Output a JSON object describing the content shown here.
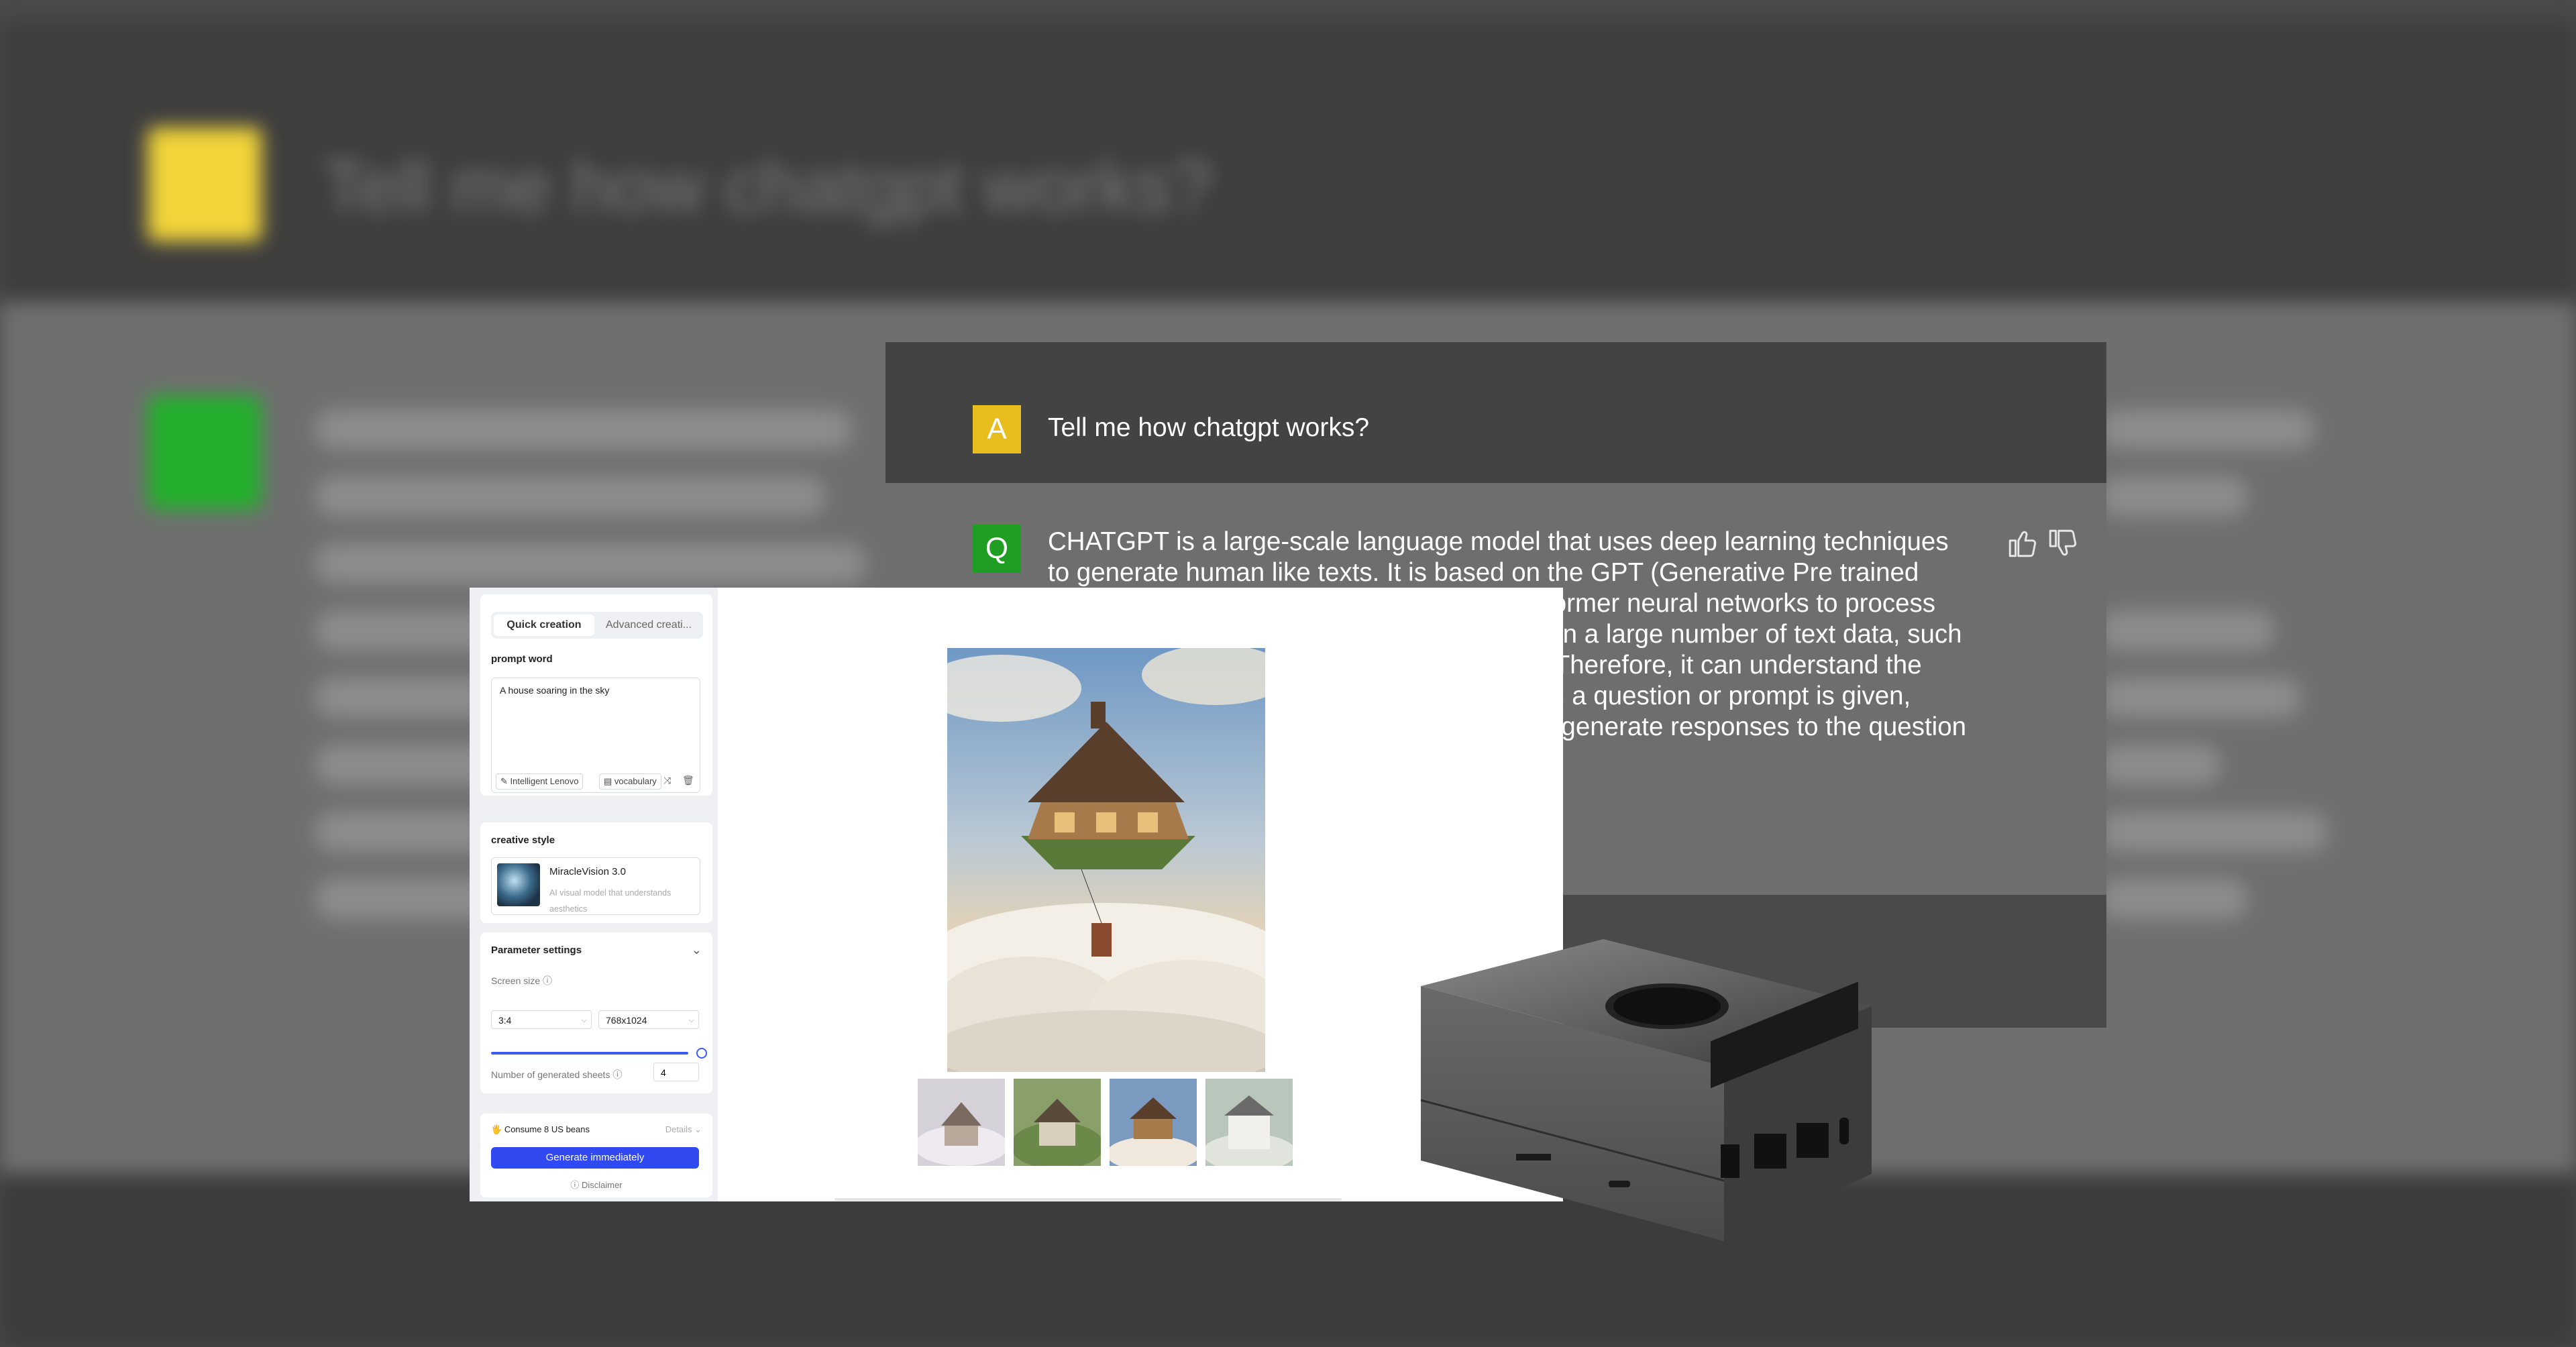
{
  "background": {
    "title": "Tell me how chatgpt works?"
  },
  "chat": {
    "question_avatar": "A",
    "question": "Tell me how chatgpt works?",
    "answer_avatar": "Q",
    "answer": "CHATGPT is a large-scale language model that uses deep learning techniques to generate human like texts. It is based on the GPT (Generative Pre trained Transformer) architecture, which uses transformer neural networks to process and generate text. The model is pre trained on a large number of text data, such as books, articles, hip contract and website. Therefore, it can understand the patterns and rules of natural language. When a question or prompt is given, ChatGPT uses this pre trained knowledge to generate responses to the question in a coherent and natural manner.",
    "icons": {
      "up": "thumbs-up-icon",
      "down": "thumbs-down-icon"
    }
  },
  "generator": {
    "tabs": [
      "Quick creation",
      "Advanced creati..."
    ],
    "prompt_label": "prompt word",
    "prompt_value": "A house soaring in the sky",
    "chip_lenovo": "Intelligent Lenovo",
    "chip_vocab": "vocabulary",
    "style_label": "creative style",
    "style_name": "MiracleVision 3.0",
    "style_desc": "AI visual model that understands aesthetics",
    "params_label": "Parameter settings",
    "screen_size_label": "Screen size",
    "ratio_value": "3:4",
    "resolution_value": "768x1024",
    "sheets_label": "Number of generated sheets",
    "sheets_value": "4",
    "consume": "Consume 8 US beans",
    "details": "Details",
    "generate": "Generate immediately",
    "disclaimer": "Disclaimer"
  },
  "colors": {
    "accent": "#3049f0",
    "avatar_a": "#e8be1f",
    "avatar_q": "#1f9e23"
  }
}
